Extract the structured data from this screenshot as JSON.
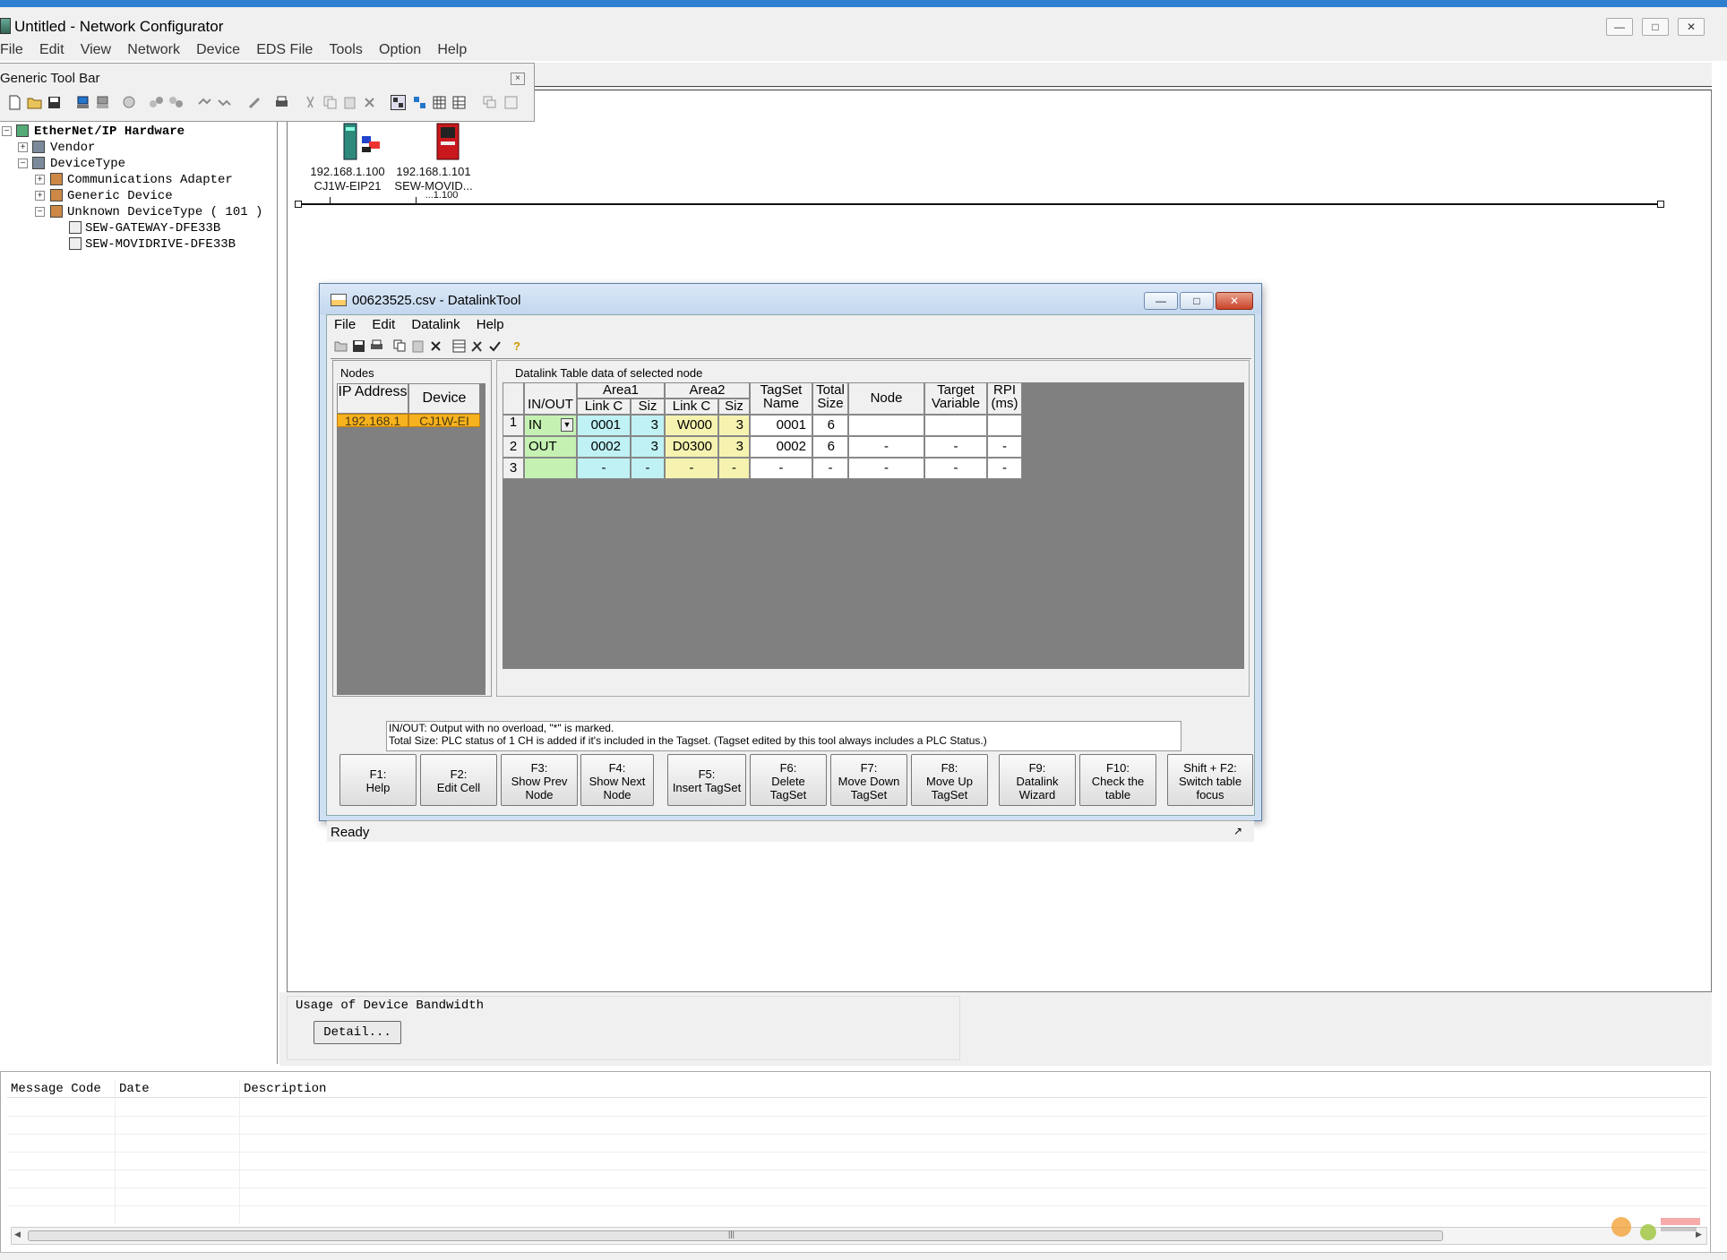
{
  "window": {
    "title": "Untitled - Network Configurator"
  },
  "menu": [
    "File",
    "Edit",
    "View",
    "Network",
    "Device",
    "EDS File",
    "Tools",
    "Option",
    "Help"
  ],
  "toolbar": {
    "title": "Generic Tool Bar"
  },
  "tree": {
    "root": "EtherNet/IP Hardware",
    "vendor": "Vendor",
    "device_type": "DeviceType",
    "comm_adapter": "Communications Adapter",
    "generic_device": "Generic Device",
    "unknown": "Unknown DeviceType ( 101 )",
    "gateway": "SEW-GATEWAY-DFE33B",
    "movidrive": "SEW-MOVIDRIVE-DFE33B"
  },
  "network": {
    "dev1_ip": "192.168.1.100",
    "dev1_name": "CJ1W-EIP21",
    "dev2_ip": "192.168.1.101",
    "dev2_name": "SEW-MOVID...",
    "dev2_sub": "...1.100"
  },
  "bandwidth": {
    "label": "Usage of Device Bandwidth",
    "detail_button": "Detail..."
  },
  "messages": {
    "columns": [
      "Message Code",
      "Date",
      "Description"
    ]
  },
  "dialog": {
    "title": "00623525.csv - DatalinkTool",
    "menu": [
      "File",
      "Edit",
      "Datalink",
      "Help"
    ],
    "nodes_label": "Nodes",
    "nodes_headers": [
      "IP Address",
      "Device"
    ],
    "node_row": [
      "192.168.1",
      "CJ1W-EI"
    ],
    "table_label": "Datalink Table data of selected node",
    "headers": {
      "inout": "IN/OUT",
      "area1": "Area1",
      "area2": "Area2",
      "link_c": "Link C",
      "siz": "Siz",
      "tagset": "TagSet Name",
      "total": "Total Size",
      "node": "Node",
      "target": "Target Variable",
      "rpi": "RPI (ms)"
    },
    "rows": [
      {
        "n": "1",
        "io": "IN",
        "a1": "0001",
        "s1": "3",
        "a2": "W000",
        "s2": "3",
        "tag": "0001",
        "total": "6",
        "node": "",
        "target": "",
        "rpi": ""
      },
      {
        "n": "2",
        "io": "OUT",
        "a1": "0002",
        "s1": "3",
        "a2": "D0300",
        "s2": "3",
        "tag": "0002",
        "total": "6",
        "node": "-",
        "target": "-",
        "rpi": "-"
      },
      {
        "n": "3",
        "io": "",
        "a1": "-",
        "s1": "-",
        "a2": "-",
        "s2": "-",
        "tag": "-",
        "total": "-",
        "node": "-",
        "target": "-",
        "rpi": "-"
      }
    ],
    "note_line1": "IN/OUT: Output with no overload, \"*\" is marked.",
    "note_line2": "Total Size: PLC status of 1 CH is added if it's included in the Tagset. (Tagset edited by this tool always includes a PLC Status.)",
    "fkeys": [
      {
        "k": "F1:",
        "t": "Help"
      },
      {
        "k": "F2:",
        "t": "Edit Cell"
      },
      {
        "k": "F3:",
        "t": "Show Prev Node"
      },
      {
        "k": "F4:",
        "t": "Show Next Node"
      },
      {
        "k": "F5:",
        "t": "Insert TagSet"
      },
      {
        "k": "F6:",
        "t": "Delete TagSet"
      },
      {
        "k": "F7:",
        "t": "Move Down TagSet"
      },
      {
        "k": "F8:",
        "t": "Move Up TagSet"
      },
      {
        "k": "F9:",
        "t": "Datalink Wizard"
      },
      {
        "k": "F10:",
        "t": "Check the table"
      },
      {
        "k": "Shift + F2:",
        "t": "Switch table focus"
      }
    ],
    "status": "Ready"
  }
}
